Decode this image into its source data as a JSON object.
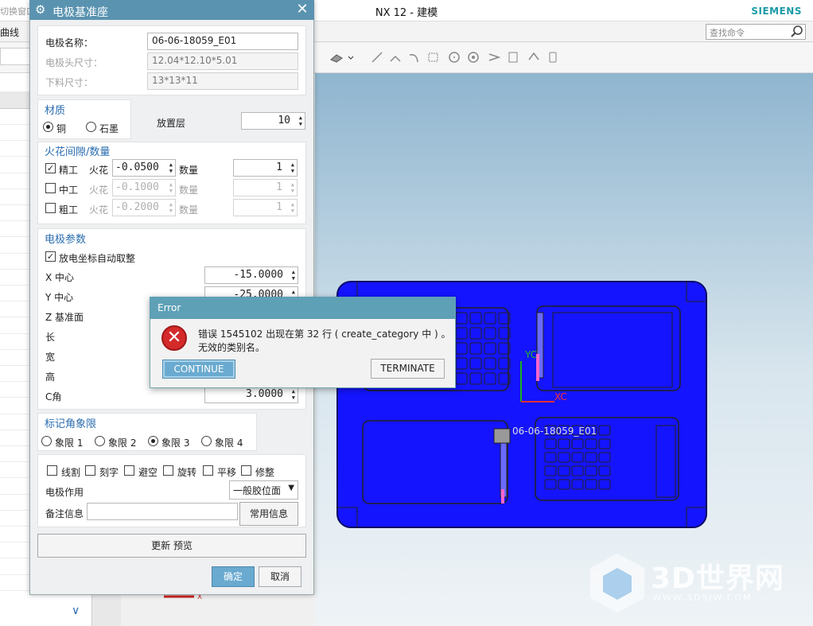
{
  "app": {
    "title": "NX 12 - 建模",
    "brand": "SIEMENS",
    "left_hint": "切换窗口",
    "menu_fragment": "曲线",
    "search_placeholder": "查找命令"
  },
  "dialog": {
    "title": "电极基准座",
    "electrode_name_label": "电极名称：",
    "electrode_name_value": "06-06-18059_E01",
    "head_size_label": "电极头尺寸：",
    "head_size_value": "12.04*12.10*5.01",
    "stock_size_label": "下料尺寸：",
    "stock_size_value": "13*13*11",
    "material": {
      "title": "材质",
      "options": [
        "铜",
        "石墨"
      ],
      "selected": "铜"
    },
    "layer_label": "放置层",
    "layer_value": "10",
    "spark": {
      "title": "火花间隙/数量",
      "spark_label": "火花",
      "qty_label": "数量",
      "rows": [
        {
          "name": "精工",
          "checked": true,
          "gap": "-0.0500",
          "qty": "1"
        },
        {
          "name": "中工",
          "checked": false,
          "gap": "-0.1000",
          "qty": "1"
        },
        {
          "name": "粗工",
          "checked": false,
          "gap": "-0.2000",
          "qty": "1"
        }
      ]
    },
    "params": {
      "title": "电极参数",
      "auto_label": "放电坐标自动取整",
      "auto_checked": true,
      "x_label": "X 中心",
      "x_value": "-15.0000",
      "y_label": "Y 中心",
      "y_value": "-25.0000",
      "z_label": "Z 基准面",
      "len_label": "长",
      "width_label": "宽",
      "height_label": "高",
      "c_label": "C角",
      "c_value": "3.0000"
    },
    "quadrant": {
      "title": "标记角象限",
      "options": [
        "象限 1",
        "象限 2",
        "象限 3",
        "象限 4"
      ],
      "selected": "象限 3"
    },
    "options": [
      "线割",
      "刻字",
      "避空",
      "旋转",
      "平移",
      "修整"
    ],
    "usage_label": "电极作用",
    "usage_value": "一般胶位面",
    "remark_label": "备注信息",
    "remark_value": "",
    "common_info_button": "常用信息",
    "update_button": "更新 预览",
    "ok_button": "确定",
    "cancel_button": "取消"
  },
  "error_dialog": {
    "title": "Error",
    "message_line1": "错误 1545102 出现在第 32 行 ( create_category 中 ) 。",
    "message_line2": "无效的类别名。",
    "continue_button": "CONTINUE",
    "terminate_button": "TERMINATE"
  },
  "viewport": {
    "part_label": "06-06-18059_E01",
    "axis_x": "XC",
    "axis_y": "YC"
  },
  "watermark": {
    "text": "3D世界网",
    "url": "WWW.3DSJW.COM"
  },
  "colors": {
    "dialog_title_bar": "#5a93b0",
    "group_title": "#2a6db0",
    "part_body": "#1414ff",
    "primary_button": "#6aaad0"
  }
}
